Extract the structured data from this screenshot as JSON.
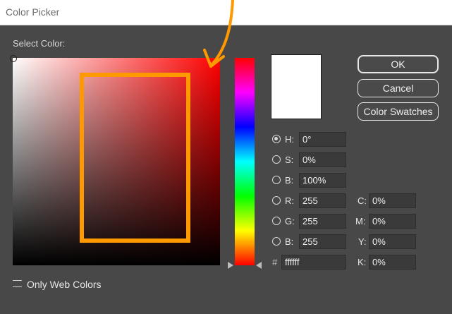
{
  "window": {
    "title": "Color Picker"
  },
  "picker": {
    "select_label": "Select Color:"
  },
  "buttons": {
    "ok": "OK",
    "cancel": "Cancel",
    "swatches": "Color Swatches"
  },
  "fields": {
    "h": {
      "label": "H:",
      "value": "0°",
      "checked": true
    },
    "s": {
      "label": "S:",
      "value": "0%"
    },
    "b": {
      "label": "B:",
      "value": "100%"
    },
    "r": {
      "label": "R:",
      "value": "255"
    },
    "g": {
      "label": "G:",
      "value": "255"
    },
    "bl": {
      "label": "B:",
      "value": "255"
    },
    "hex": {
      "label": "#",
      "value": "ffffff"
    },
    "c": {
      "label": "C:",
      "value": "0%"
    },
    "m": {
      "label": "M:",
      "value": "0%"
    },
    "y": {
      "label": "Y:",
      "value": "0%"
    },
    "k": {
      "label": "K:",
      "value": "0%"
    }
  },
  "web_colors": {
    "label": "Only Web Colors",
    "checked": false
  },
  "colors": {
    "current_color": "#ffffff",
    "hue_color": "#ff0000",
    "annotation": "#ff9900"
  }
}
